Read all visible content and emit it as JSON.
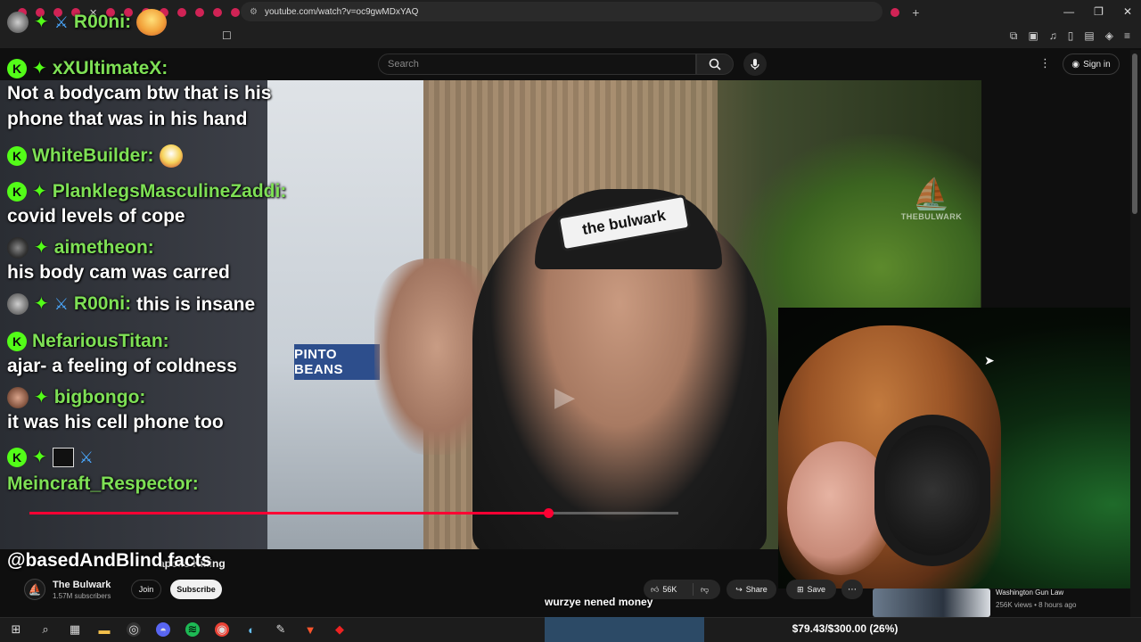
{
  "browser": {
    "url": "youtube.com/watch?v=oc9gwMDxYAQ",
    "window_controls": [
      "—",
      "❐",
      "✕"
    ]
  },
  "youtube": {
    "search_placeholder": "Search",
    "sign_in_label": "Sign in",
    "video": {
      "title_fragment": "apolis Killing",
      "watermark": "THEBULWARK",
      "cap_text": "the bulwark",
      "poster_text": "PINTO BEANS",
      "progress_fraction": 0.8
    },
    "channel": {
      "name": "The Bulwark",
      "subscribers": "1.57M subscribers",
      "join_label": "Join",
      "subscribe_label": "Subscribe"
    },
    "actions": {
      "likes": "56K",
      "share_label": "Share",
      "save_label": "Save"
    },
    "caption": "wurzye nened money",
    "recommended": {
      "title": "Washington Gun Law",
      "meta": "256K views • 8 hours ago"
    }
  },
  "chat": {
    "top_user": "R00ni:",
    "messages": [
      {
        "user": "xXUltimateX:",
        "text": "Not a bodycam btw that is his phone that was in his hand"
      },
      {
        "user": "WhiteBuilder:",
        "text": ""
      },
      {
        "user": "PlanklegsMasculineZaddi:",
        "text": "covid levels of cope"
      },
      {
        "user": "aimetheon:",
        "text": "his body cam was carred"
      },
      {
        "user": "R00ni:",
        "text": "this is insane"
      },
      {
        "user": "NefariousTitan:",
        "text": "ajar- a feeling of coldness"
      },
      {
        "user": "bigbongo:",
        "text": "it was his cell phone too"
      },
      {
        "user": "Meincraft_Respector:",
        "text": "@basedAndBlind facts"
      }
    ]
  },
  "stream_overlay": {
    "goal": "$79.43/$300.00 (26%)"
  },
  "colors": {
    "chat_name": "#7ee055",
    "kick_green": "#53fc18",
    "progress_red": "#ff0033",
    "yt_bg": "#0f0f0f"
  }
}
